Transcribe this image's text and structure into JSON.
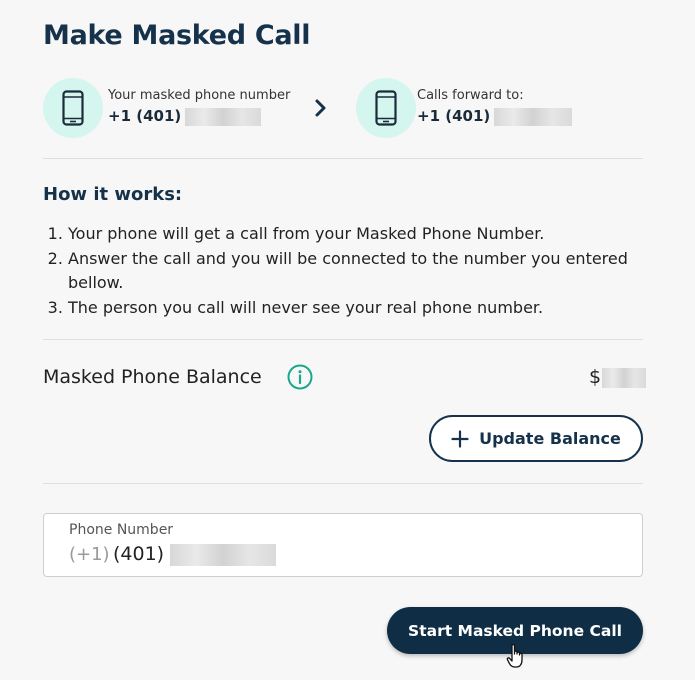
{
  "page": {
    "title": "Make Masked Call"
  },
  "flow": {
    "masked_caption": "Your masked phone number",
    "masked_number": "+1 (401)",
    "forward_caption": "Calls forward to:",
    "forward_number": "+1 (401)"
  },
  "how": {
    "title": "How it works:",
    "steps": [
      "Your phone will get a call from your Masked Phone Number.",
      "Answer the call and you will be connected to the number you entered bellow.",
      "The person you call will never see your real phone number."
    ]
  },
  "balance": {
    "label": "Masked Phone Balance",
    "value": "$"
  },
  "update_button": {
    "label": "Update Balance"
  },
  "phone_input": {
    "label": "Phone Number",
    "prefix": "(+1)",
    "value": "(401)"
  },
  "start_button": {
    "label": "Start Masked Phone Call"
  },
  "colors": {
    "navy": "#15324a",
    "mint": "#d5f5ef",
    "teal": "#1aa88c",
    "button_dark": "#0f2d44"
  },
  "icons": [
    "mobile-phone-icon",
    "chevron-right-icon",
    "info-icon",
    "plus-icon",
    "hand-cursor-icon"
  ]
}
